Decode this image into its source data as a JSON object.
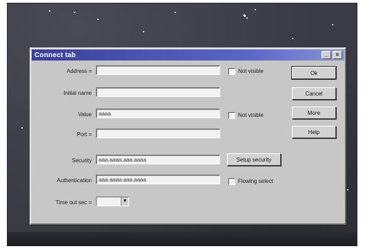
{
  "window": {
    "title": "Connect tab"
  },
  "fields": {
    "address_label": "Address =",
    "address_value": "",
    "bookmark_label": "Initial name",
    "bookmark_value": "",
    "value_label": "Value",
    "value_value": "aaaa",
    "port_label": "Port =",
    "port_value": "",
    "security_label": "Security",
    "security_value": "aaa.aaaa.aaa.aaaa",
    "auth_label": "Authentication",
    "auth_value": "aaa.aaaa.aaa.aaaa",
    "timeout_label": "Time out sec =",
    "timeout_value": ""
  },
  "checks": {
    "check1_label": "Not visible",
    "check2_label": "Not visible",
    "check3_label": "Flowing select"
  },
  "buttons": {
    "ok": "Ok",
    "cancel": "Cancel",
    "more": "More",
    "help": "Help",
    "setup_security": "Setup security"
  }
}
